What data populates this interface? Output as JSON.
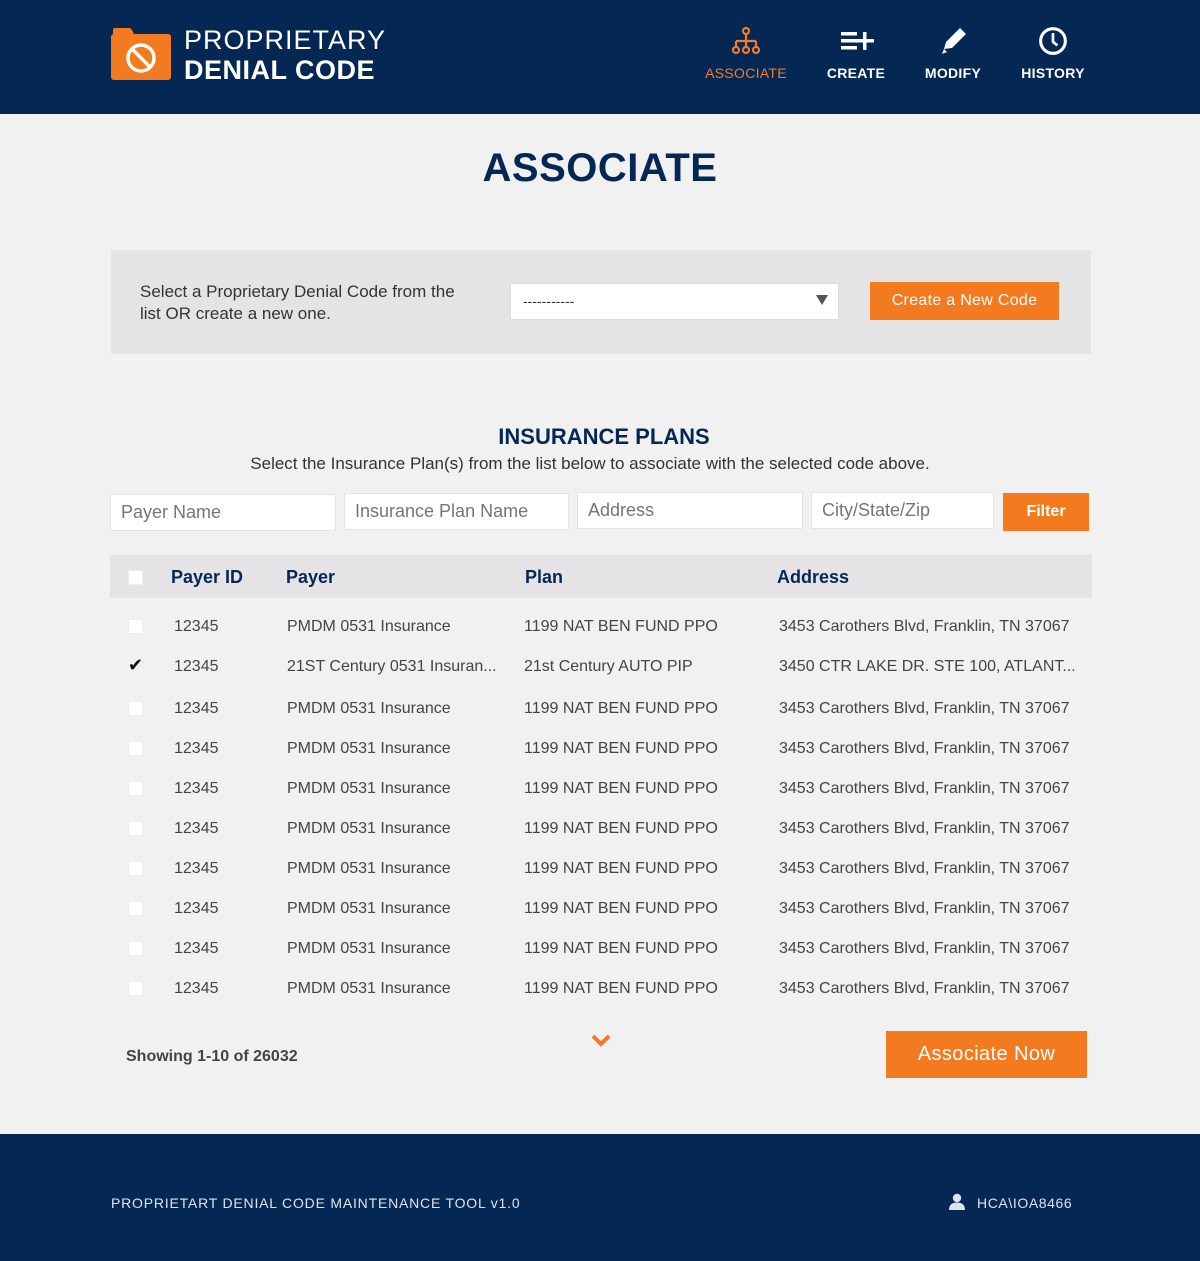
{
  "header": {
    "logo_line1": "PROPRIETARY",
    "logo_line2": "DENIAL CODE",
    "nav": [
      {
        "label": "ASSOCIATE",
        "icon": "hierarchy-icon",
        "active": true
      },
      {
        "label": "CREATE",
        "icon": "list-add-icon",
        "active": false
      },
      {
        "label": "MODIFY",
        "icon": "pencil-icon",
        "active": false
      },
      {
        "label": "HISTORY",
        "icon": "clock-icon",
        "active": false
      }
    ]
  },
  "page": {
    "title": "ASSOCIATE"
  },
  "code_select": {
    "instruction": "Select a Proprietary Denial Code from the list OR create a new one.",
    "selected_value": "-----------",
    "create_button": "Create a New Code"
  },
  "plans": {
    "title": "INSURANCE PLANS",
    "subtitle": "Select the Insurance Plan(s) from the list below to associate with the selected code above.",
    "filters": {
      "payer_name": "Payer Name",
      "plan_name": "Insurance Plan Name",
      "address": "Address",
      "city_state_zip": "City/State/Zip",
      "filter_button": "Filter"
    },
    "columns": [
      "Payer ID",
      "Payer",
      "Plan",
      "Address"
    ],
    "rows": [
      {
        "checked": false,
        "payer_id": "12345",
        "payer": "PMDM 0531 Insurance",
        "plan": "1199 NAT BEN FUND PPO",
        "address": "3453 Carothers Blvd, Franklin, TN 37067"
      },
      {
        "checked": true,
        "payer_id": "12345",
        "payer": "21ST Century 0531 Insuran...",
        "plan": "21st Century AUTO PIP",
        "address": "3450 CTR LAKE DR. STE 100, ATLANT..."
      },
      {
        "checked": false,
        "payer_id": "12345",
        "payer": "PMDM 0531 Insurance",
        "plan": "1199 NAT BEN FUND PPO",
        "address": "3453 Carothers Blvd, Franklin, TN 37067"
      },
      {
        "checked": false,
        "payer_id": "12345",
        "payer": "PMDM 0531 Insurance",
        "plan": "1199 NAT BEN FUND PPO",
        "address": "3453 Carothers Blvd, Franklin, TN 37067"
      },
      {
        "checked": false,
        "payer_id": "12345",
        "payer": "PMDM 0531 Insurance",
        "plan": "1199 NAT BEN FUND PPO",
        "address": "3453 Carothers Blvd, Franklin, TN 37067"
      },
      {
        "checked": false,
        "payer_id": "12345",
        "payer": "PMDM 0531 Insurance",
        "plan": "1199 NAT BEN FUND PPO",
        "address": "3453 Carothers Blvd, Franklin, TN 37067"
      },
      {
        "checked": false,
        "payer_id": "12345",
        "payer": "PMDM 0531 Insurance",
        "plan": "1199 NAT BEN FUND PPO",
        "address": "3453 Carothers Blvd, Franklin, TN 37067"
      },
      {
        "checked": false,
        "payer_id": "12345",
        "payer": "PMDM 0531 Insurance",
        "plan": "1199 NAT BEN FUND PPO",
        "address": "3453 Carothers Blvd, Franklin, TN 37067"
      },
      {
        "checked": false,
        "payer_id": "12345",
        "payer": "PMDM 0531 Insurance",
        "plan": "1199 NAT BEN FUND PPO",
        "address": "3453 Carothers Blvd, Franklin, TN 37067"
      },
      {
        "checked": false,
        "payer_id": "12345",
        "payer": "PMDM 0531 Insurance",
        "plan": "1199 NAT BEN FUND PPO",
        "address": "3453 Carothers Blvd, Franklin, TN 37067"
      }
    ],
    "showing": "Showing 1-10 of 26032",
    "associate_button": "Associate Now"
  },
  "footer": {
    "tool_name": "PROPRIETART DENIAL CODE MAINTENANCE TOOL v1.0",
    "user": "HCA\\IOA8466"
  },
  "colors": {
    "navy": "#052754",
    "orange": "#f47a20",
    "background": "#f1f1f1"
  }
}
